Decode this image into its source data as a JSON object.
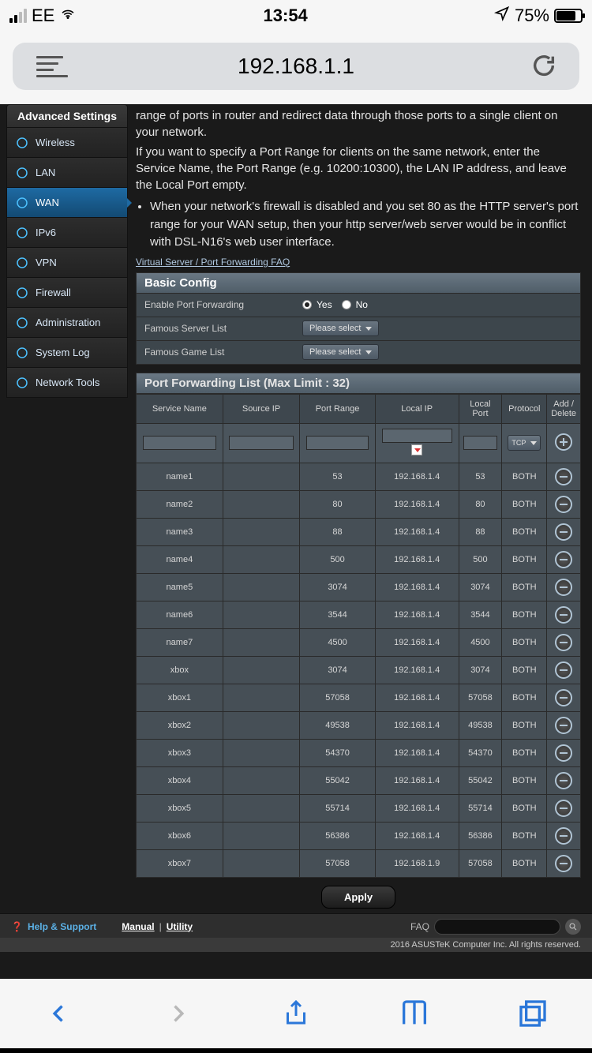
{
  "status": {
    "carrier": "EE",
    "time": "13:54",
    "battery_pct": "75%"
  },
  "url": "192.168.1.1",
  "sidebar": {
    "header": "Advanced Settings",
    "items": [
      {
        "label": "Wireless",
        "icon": "wifi-icon"
      },
      {
        "label": "LAN",
        "icon": "home-icon"
      },
      {
        "label": "WAN",
        "icon": "globe-icon",
        "active": true
      },
      {
        "label": "IPv6",
        "icon": "ipv6-icon"
      },
      {
        "label": "VPN",
        "icon": "vpn-icon"
      },
      {
        "label": "Firewall",
        "icon": "shield-icon"
      },
      {
        "label": "Administration",
        "icon": "user-icon"
      },
      {
        "label": "System Log",
        "icon": "log-icon"
      },
      {
        "label": "Network Tools",
        "icon": "wrench-icon"
      }
    ]
  },
  "desc": {
    "p1": "range of ports in router and redirect data through those ports to a single client on your network.",
    "p2": "If you want to specify a Port Range for clients on the same network, enter the Service Name, the Port Range (e.g. 10200:10300), the LAN IP address, and leave the Local Port empty.",
    "li1": "When your network's firewall is disabled and you set 80 as the HTTP server's port range for your WAN setup, then your http server/web server would be in conflict with DSL-N16's web user interface.",
    "faq": "Virtual Server / Port Forwarding FAQ"
  },
  "config": {
    "header": "Basic Config",
    "enable_label": "Enable Port Forwarding",
    "yes": "Yes",
    "no": "No",
    "server_list_label": "Famous Server List",
    "game_list_label": "Famous Game List",
    "please_select": "Please select"
  },
  "list": {
    "header": "Port Forwarding List (Max Limit : 32)",
    "columns": {
      "service": "Service Name",
      "source": "Source IP",
      "port_range": "Port Range",
      "local_ip": "Local IP",
      "local_port": "Local Port",
      "protocol": "Protocol",
      "add_delete": "Add / Delete"
    },
    "protocol_default": "TCP",
    "rows": [
      {
        "service": "name1",
        "source": "",
        "port_range": "53",
        "local_ip": "192.168.1.4",
        "local_port": "53",
        "protocol": "BOTH"
      },
      {
        "service": "name2",
        "source": "",
        "port_range": "80",
        "local_ip": "192.168.1.4",
        "local_port": "80",
        "protocol": "BOTH"
      },
      {
        "service": "name3",
        "source": "",
        "port_range": "88",
        "local_ip": "192.168.1.4",
        "local_port": "88",
        "protocol": "BOTH"
      },
      {
        "service": "name4",
        "source": "",
        "port_range": "500",
        "local_ip": "192.168.1.4",
        "local_port": "500",
        "protocol": "BOTH"
      },
      {
        "service": "name5",
        "source": "",
        "port_range": "3074",
        "local_ip": "192.168.1.4",
        "local_port": "3074",
        "protocol": "BOTH"
      },
      {
        "service": "name6",
        "source": "",
        "port_range": "3544",
        "local_ip": "192.168.1.4",
        "local_port": "3544",
        "protocol": "BOTH"
      },
      {
        "service": "name7",
        "source": "",
        "port_range": "4500",
        "local_ip": "192.168.1.4",
        "local_port": "4500",
        "protocol": "BOTH"
      },
      {
        "service": "xbox",
        "source": "",
        "port_range": "3074",
        "local_ip": "192.168.1.4",
        "local_port": "3074",
        "protocol": "BOTH"
      },
      {
        "service": "xbox1",
        "source": "",
        "port_range": "57058",
        "local_ip": "192.168.1.4",
        "local_port": "57058",
        "protocol": "BOTH"
      },
      {
        "service": "xbox2",
        "source": "",
        "port_range": "49538",
        "local_ip": "192.168.1.4",
        "local_port": "49538",
        "protocol": "BOTH"
      },
      {
        "service": "xbox3",
        "source": "",
        "port_range": "54370",
        "local_ip": "192.168.1.4",
        "local_port": "54370",
        "protocol": "BOTH"
      },
      {
        "service": "xbox4",
        "source": "",
        "port_range": "55042",
        "local_ip": "192.168.1.4",
        "local_port": "55042",
        "protocol": "BOTH"
      },
      {
        "service": "xbox5",
        "source": "",
        "port_range": "55714",
        "local_ip": "192.168.1.4",
        "local_port": "55714",
        "protocol": "BOTH"
      },
      {
        "service": "xbox6",
        "source": "",
        "port_range": "56386",
        "local_ip": "192.168.1.4",
        "local_port": "56386",
        "protocol": "BOTH"
      },
      {
        "service": "xbox7",
        "source": "",
        "port_range": "57058",
        "local_ip": "192.168.1.9",
        "local_port": "57058",
        "protocol": "BOTH"
      }
    ]
  },
  "apply_label": "Apply",
  "footer": {
    "help": "Help & Support",
    "manual": "Manual",
    "utility": "Utility",
    "faq": "FAQ",
    "sep": " | "
  },
  "copyright": "2016 ASUSTeK Computer Inc. All rights reserved."
}
